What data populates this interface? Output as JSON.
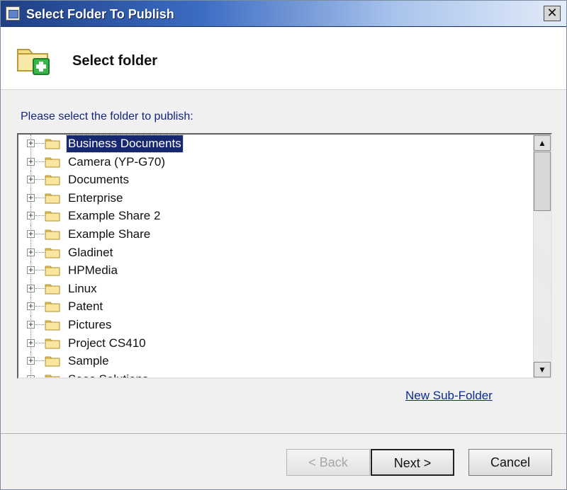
{
  "window": {
    "title": "Select Folder To Publish",
    "close_label": "✕"
  },
  "header": {
    "title": "Select folder"
  },
  "instruction": "Please select the folder to publish:",
  "folders": [
    {
      "label": "Business Documents",
      "selected": true
    },
    {
      "label": "Camera (YP-G70)",
      "selected": false
    },
    {
      "label": "Documents",
      "selected": false
    },
    {
      "label": "Enterprise",
      "selected": false
    },
    {
      "label": "Example Share 2",
      "selected": false
    },
    {
      "label": "Example Share",
      "selected": false
    },
    {
      "label": "Gladinet",
      "selected": false
    },
    {
      "label": "HPMedia",
      "selected": false
    },
    {
      "label": "Linux",
      "selected": false
    },
    {
      "label": "Patent",
      "selected": false
    },
    {
      "label": "Pictures",
      "selected": false
    },
    {
      "label": "Project CS410",
      "selected": false
    },
    {
      "label": "Sample",
      "selected": false
    },
    {
      "label": "Saas Solutions",
      "selected": false
    }
  ],
  "links": {
    "new_subfolder": "New Sub-Folder"
  },
  "buttons": {
    "back": "< Back",
    "next": "Next >",
    "cancel": "Cancel"
  },
  "colors": {
    "selection": "#16286f",
    "link": "#0b2a95",
    "titlebar": "#1e3f84"
  }
}
